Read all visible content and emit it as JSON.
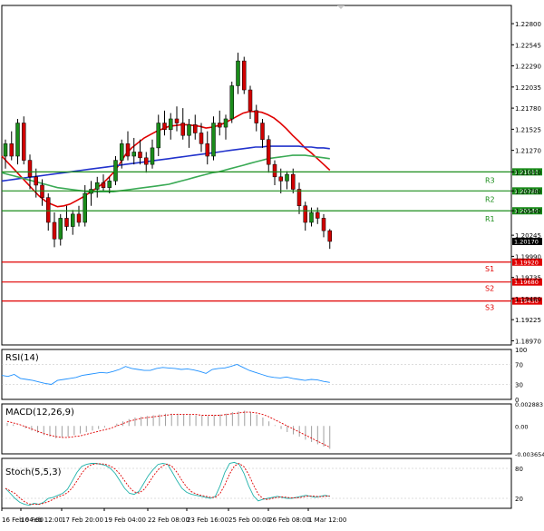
{
  "chart_data": {
    "type": "candlestick",
    "price_axis": {
      "ticks": [
        "1.22800",
        "1.22545",
        "1.22290",
        "1.22035",
        "1.21780",
        "1.21525",
        "1.21270",
        "1.21010",
        "1.20780",
        "1.20540",
        "1.20245",
        "1.19990",
        "1.19735",
        "1.19480",
        "1.19225",
        "1.18970"
      ],
      "ylim": [
        1.1892,
        1.2302
      ]
    },
    "levels": [
      {
        "name": "R3",
        "value": "1.21010",
        "numeric": 1.2101,
        "color": "#1a8c1a"
      },
      {
        "name": "R2",
        "value": "1.20780",
        "numeric": 1.2078,
        "color": "#1a8c1a"
      },
      {
        "name": "R1",
        "value": "1.20540",
        "numeric": 1.2054,
        "color": "#1a8c1a"
      },
      {
        "name": "S1",
        "value": "1.19920",
        "numeric": 1.1992,
        "color": "#e00000"
      },
      {
        "name": "S2",
        "value": "1.19680",
        "numeric": 1.1968,
        "color": "#e00000"
      },
      {
        "name": "S3",
        "value": "1.19450",
        "numeric": 1.1945,
        "color": "#e00000"
      }
    ],
    "current_price": {
      "value": "1.20170",
      "numeric": 1.2017
    },
    "x_labels": [
      "16 Feb 04:00",
      "16 Feb 12:00",
      "17 Feb 20:00",
      "19 Feb 04:00",
      "22 Feb 08:00",
      "23 Feb 16:00",
      "25 Feb 00:00",
      "26 Feb 08:00",
      "1 Mar 12:00"
    ],
    "candles": [
      [
        1.212,
        1.214,
        1.2105,
        1.2135
      ],
      [
        1.2135,
        1.215,
        1.2115,
        1.212
      ],
      [
        1.212,
        1.2165,
        1.211,
        1.216
      ],
      [
        1.216,
        1.2168,
        1.211,
        1.2115
      ],
      [
        1.2115,
        1.2122,
        1.208,
        1.2095
      ],
      [
        1.2095,
        1.2105,
        1.207,
        1.2085
      ],
      [
        1.2085,
        1.2092,
        1.206,
        1.207
      ],
      [
        1.207,
        1.2075,
        1.203,
        1.204
      ],
      [
        1.204,
        1.2052,
        1.201,
        1.202
      ],
      [
        1.202,
        1.205,
        1.2012,
        1.2045
      ],
      [
        1.2045,
        1.206,
        1.203,
        1.2035
      ],
      [
        1.2035,
        1.2055,
        1.2025,
        1.205
      ],
      [
        1.205,
        1.206,
        1.2035,
        1.204
      ],
      [
        1.204,
        1.2085,
        1.2035,
        1.2075
      ],
      [
        1.2075,
        1.209,
        1.206,
        1.208
      ],
      [
        1.208,
        1.2095,
        1.207,
        1.2088
      ],
      [
        1.2088,
        1.2098,
        1.2078,
        1.2082
      ],
      [
        1.2082,
        1.2095,
        1.2075,
        1.209
      ],
      [
        1.209,
        1.212,
        1.2085,
        1.2115
      ],
      [
        1.2115,
        1.214,
        1.2105,
        1.2135
      ],
      [
        1.2135,
        1.215,
        1.2115,
        1.212
      ],
      [
        1.212,
        1.2142,
        1.211,
        1.2125
      ],
      [
        1.2125,
        1.214,
        1.211,
        1.2118
      ],
      [
        1.2118,
        1.2125,
        1.21,
        1.211
      ],
      [
        1.211,
        1.214,
        1.2105,
        1.213
      ],
      [
        1.213,
        1.217,
        1.212,
        1.216
      ],
      [
        1.216,
        1.2175,
        1.2145,
        1.2152
      ],
      [
        1.2152,
        1.2172,
        1.214,
        1.2165
      ],
      [
        1.2165,
        1.218,
        1.215,
        1.216
      ],
      [
        1.216,
        1.2178,
        1.214,
        1.2145
      ],
      [
        1.2145,
        1.2165,
        1.213,
        1.2158
      ],
      [
        1.2158,
        1.217,
        1.214,
        1.2148
      ],
      [
        1.2148,
        1.216,
        1.2125,
        1.2135
      ],
      [
        1.2135,
        1.215,
        1.211,
        1.212
      ],
      [
        1.212,
        1.2168,
        1.2115,
        1.216
      ],
      [
        1.216,
        1.2175,
        1.2145,
        1.2155
      ],
      [
        1.2155,
        1.217,
        1.214,
        1.2165
      ],
      [
        1.2165,
        1.221,
        1.216,
        1.2205
      ],
      [
        1.2205,
        1.2245,
        1.2195,
        1.2235
      ],
      [
        1.2235,
        1.224,
        1.2195,
        1.22
      ],
      [
        1.22,
        1.2205,
        1.2165,
        1.2175
      ],
      [
        1.2175,
        1.2182,
        1.215,
        1.216
      ],
      [
        1.216,
        1.2165,
        1.213,
        1.214
      ],
      [
        1.214,
        1.2145,
        1.21,
        1.211
      ],
      [
        1.211,
        1.2115,
        1.2085,
        1.2095
      ],
      [
        1.2095,
        1.2105,
        1.2075,
        1.209
      ],
      [
        1.209,
        1.2102,
        1.208,
        1.2098
      ],
      [
        1.2098,
        1.2105,
        1.2075,
        1.208
      ],
      [
        1.208,
        1.2088,
        1.205,
        1.206
      ],
      [
        1.206,
        1.2065,
        1.203,
        1.204
      ],
      [
        1.204,
        1.2058,
        1.2035,
        1.2052
      ],
      [
        1.2052,
        1.2058,
        1.2038,
        1.2045
      ],
      [
        1.2045,
        1.205,
        1.2022,
        1.203
      ],
      [
        1.203,
        1.2032,
        1.2008,
        1.2017
      ]
    ],
    "moving_averages": [
      {
        "color": "#e00000",
        "values": [
          1.212,
          1.2112,
          1.2104,
          1.2096,
          1.2088,
          1.208,
          1.2072,
          1.2066,
          1.2062,
          1.2059,
          1.206,
          1.2062,
          1.2066,
          1.207,
          1.2075,
          1.208,
          1.2085,
          1.2092,
          1.21,
          1.211,
          1.2122,
          1.213,
          1.2136,
          1.2142,
          1.2146,
          1.215,
          1.2153,
          1.2156,
          1.2157,
          1.2158,
          1.2158,
          1.2157,
          1.2156,
          1.2154,
          1.2155,
          1.2157,
          1.216,
          1.2164,
          1.2168,
          1.2172,
          1.2174,
          1.2174,
          1.2173,
          1.217,
          1.2166,
          1.216,
          1.2153,
          1.2145,
          1.2138,
          1.213,
          1.2124,
          1.2117,
          1.211,
          1.2103
        ]
      },
      {
        "color": "#2233cc",
        "values": [
          1.209,
          1.2091,
          1.2092,
          1.2093,
          1.2094,
          1.2095,
          1.2096,
          1.2097,
          1.2098,
          1.2099,
          1.21,
          1.2101,
          1.2102,
          1.2103,
          1.2104,
          1.2105,
          1.2106,
          1.2107,
          1.2108,
          1.2109,
          1.211,
          1.2111,
          1.2112,
          1.2113,
          1.2114,
          1.2115,
          1.2116,
          1.2117,
          1.2118,
          1.2119,
          1.212,
          1.2121,
          1.2122,
          1.2123,
          1.2124,
          1.2125,
          1.2126,
          1.2127,
          1.2128,
          1.2129,
          1.213,
          1.2131,
          1.2131,
          1.2132,
          1.2132,
          1.2132,
          1.2132,
          1.2132,
          1.2132,
          1.2131,
          1.2131,
          1.213,
          1.213,
          1.2129
        ]
      },
      {
        "color": "#3aaa55",
        "values": [
          1.21,
          1.2098,
          1.2096,
          1.2094,
          1.2092,
          1.209,
          1.2088,
          1.2086,
          1.2084,
          1.2082,
          1.2081,
          1.208,
          1.2079,
          1.2078,
          1.2077,
          1.2077,
          1.2077,
          1.2077,
          1.2077,
          1.2078,
          1.2079,
          1.208,
          1.2081,
          1.2082,
          1.2083,
          1.2084,
          1.2085,
          1.2086,
          1.2088,
          1.209,
          1.2092,
          1.2094,
          1.2096,
          1.2098,
          1.21,
          1.2101,
          1.2103,
          1.2105,
          1.2107,
          1.2109,
          1.2111,
          1.2113,
          1.2115,
          1.2117,
          1.2118,
          1.2119,
          1.212,
          1.2121,
          1.2121,
          1.2121,
          1.212,
          1.2119,
          1.2118,
          1.2117
        ]
      }
    ],
    "rsi": {
      "label": "RSI(14)",
      "ticks": [
        "100",
        "70",
        "30",
        "0"
      ],
      "values": [
        48,
        46,
        50,
        42,
        40,
        38,
        35,
        32,
        30,
        38,
        40,
        42,
        44,
        48,
        50,
        52,
        54,
        53,
        56,
        60,
        66,
        62,
        60,
        58,
        58,
        62,
        64,
        63,
        62,
        60,
        61,
        59,
        56,
        52,
        60,
        62,
        63,
        66,
        70,
        64,
        58,
        54,
        50,
        46,
        44,
        43,
        45,
        42,
        40,
        38,
        40,
        39,
        36,
        34
      ]
    },
    "macd": {
      "label": "MACD(12,26,9)",
      "ticks": [
        "0.002883",
        "0.00",
        "-0.003654"
      ],
      "histogram": [
        0.0004,
        0.0002,
        0.0,
        -0.0003,
        -0.0006,
        -0.0009,
        -0.0012,
        -0.0014,
        -0.0016,
        -0.0015,
        -0.0014,
        -0.0012,
        -0.001,
        -0.0008,
        -0.0006,
        -0.0004,
        -0.0002,
        0.0,
        0.0003,
        0.0006,
        0.0009,
        0.0011,
        0.0012,
        0.0013,
        0.0014,
        0.0015,
        0.0016,
        0.0016,
        0.0016,
        0.0015,
        0.0015,
        0.0014,
        0.0014,
        0.0013,
        0.0014,
        0.0015,
        0.0016,
        0.0018,
        0.0019,
        0.002,
        0.0018,
        0.0015,
        0.0011,
        0.0006,
        0.0001,
        -0.0004,
        -0.0008,
        -0.0011,
        -0.0014,
        -0.0018,
        -0.0021,
        -0.0024,
        -0.0027,
        -0.003
      ],
      "signal": [
        0.0006,
        0.0004,
        0.0002,
        -0.0001,
        -0.0004,
        -0.0007,
        -0.001,
        -0.0012,
        -0.0014,
        -0.0015,
        -0.0015,
        -0.0014,
        -0.0013,
        -0.0011,
        -0.0009,
        -0.0007,
        -0.0005,
        -0.0003,
        0.0,
        0.0003,
        0.0006,
        0.0008,
        0.001,
        0.0011,
        0.0012,
        0.0013,
        0.0014,
        0.0015,
        0.0015,
        0.0015,
        0.0015,
        0.0015,
        0.0014,
        0.0014,
        0.0014,
        0.0014,
        0.0015,
        0.0016,
        0.0017,
        0.0018,
        0.0018,
        0.0017,
        0.0015,
        0.0012,
        0.0008,
        0.0004,
        0.0,
        -0.0004,
        -0.0008,
        -0.0012,
        -0.0016,
        -0.002,
        -0.0024,
        -0.0028
      ]
    },
    "stoch": {
      "label": "Stoch(5,5,3)",
      "ticks": [
        "80",
        "20"
      ],
      "main": [
        40,
        30,
        20,
        12,
        8,
        6,
        10,
        8,
        12,
        20,
        22,
        26,
        30,
        38,
        55,
        72,
        84,
        88,
        90,
        90,
        88,
        86,
        80,
        70,
        55,
        40,
        30,
        28,
        34,
        50,
        66,
        78,
        88,
        90,
        88,
        72,
        55,
        40,
        32,
        28,
        26,
        24,
        22,
        20,
        24,
        45,
        72,
        90,
        92,
        88,
        70,
        45,
        25,
        15,
        18,
        20,
        22,
        24,
        22,
        20,
        20,
        22,
        24,
        26,
        24,
        22,
        24,
        26,
        24
      ]
    }
  }
}
